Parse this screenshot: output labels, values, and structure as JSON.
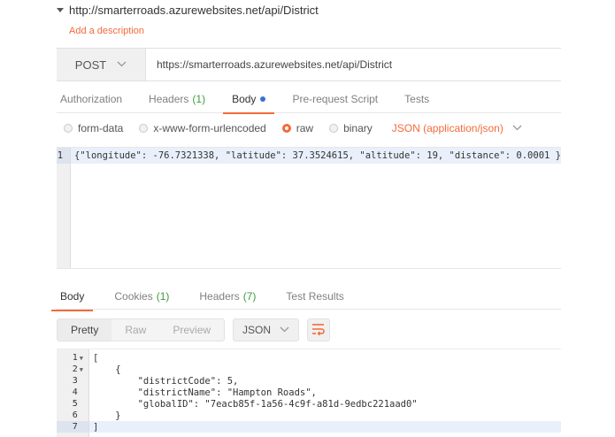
{
  "request": {
    "title": "http://smarterroads.azurewebsites.net/api/District",
    "add_description": "Add a description",
    "method": "POST",
    "url": "https://smarterroads.azurewebsites.net/api/District"
  },
  "request_tabs": {
    "authorization": "Authorization",
    "headers": "Headers",
    "headers_count": "(1)",
    "body": "Body",
    "pre_request": "Pre-request Script",
    "tests": "Tests"
  },
  "body_options": {
    "form_data": "form-data",
    "urlencoded": "x-www-form-urlencoded",
    "raw": "raw",
    "binary": "binary",
    "content_type": "JSON (application/json)",
    "selected": "raw"
  },
  "request_body": {
    "line_number": "1",
    "code": "{\"longitude\": -76.7321338, \"latitude\": 37.3524615, \"altitude\": 19, \"distance\": 0.0001 }"
  },
  "response_tabs": {
    "body": "Body",
    "cookies": "Cookies",
    "cookies_count": "(1)",
    "headers": "Headers",
    "headers_count": "(7)",
    "test_results": "Test Results"
  },
  "response_toolbar": {
    "pretty": "Pretty",
    "raw": "Raw",
    "preview": "Preview",
    "format": "JSON"
  },
  "response_body": {
    "lines": [
      "[",
      "    {",
      "        \"districtCode\": 5,",
      "        \"districtName\": \"Hampton Roads\",",
      "        \"globalID\": \"7eacb85f-1a56-4c9f-a81d-9edbc221aad0\"",
      "    }",
      "]"
    ],
    "numbers": [
      "1",
      "2",
      "3",
      "4",
      "5",
      "6",
      "7"
    ]
  },
  "colors": {
    "accent": "#f26b3a",
    "count_green": "#3e9b3f",
    "dot_blue": "#3d6fd6"
  }
}
